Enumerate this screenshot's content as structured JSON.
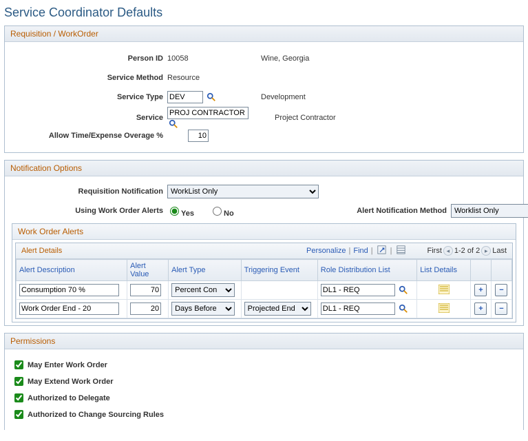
{
  "page_title": "Service Coordinator Defaults",
  "req": {
    "title": "Requisition / WorkOrder",
    "person_id_label": "Person ID",
    "person_id": "10058",
    "person_name": "Wine, Georgia",
    "service_method_label": "Service Method",
    "service_method": "Resource",
    "service_type_label": "Service Type",
    "service_type_value": "DEV",
    "service_type_desc": "Development",
    "service_label": "Service",
    "service_value": "PROJ CONTRACTOR",
    "service_desc": "Project Contractor",
    "overage_label": "Allow Time/Expense Overage %",
    "overage_value": "10"
  },
  "notif": {
    "title": "Notification Options",
    "req_notif_label": "Requisition Notification",
    "req_notif_value": "WorkList Only",
    "using_alerts_label": "Using Work Order Alerts",
    "yes_label": "Yes",
    "no_label": "No",
    "using_alerts": "Yes",
    "alert_method_label": "Alert Notification Method",
    "alert_method_value": "Worklist Only"
  },
  "alerts": {
    "grid_title": "Work Order Alerts",
    "sub_title": "Alert Details",
    "personalize": "Personalize",
    "find": "Find",
    "first": "First",
    "range": "1-2 of 2",
    "last": "Last",
    "cols": {
      "desc": "Alert Description",
      "value": "Alert Value",
      "type": "Alert Type",
      "trigger": "Triggering Event",
      "rdl": "Role Distribution List",
      "list": "List Details"
    },
    "rows": [
      {
        "desc": "Consumption 70 %",
        "value": "70",
        "type": "Percent Con",
        "trigger": "",
        "rdl": "DL1 - REQ"
      },
      {
        "desc": "Work Order End - 20",
        "value": "20",
        "type": "Days Before",
        "trigger": "Projected End",
        "rdl": "DL1 - REQ"
      }
    ]
  },
  "perm": {
    "title": "Permissions",
    "p1": "May Enter Work Order",
    "p2": "May Extend Work Order",
    "p3": "Authorized to Delegate",
    "p4": "Authorized to Change Sourcing Rules"
  }
}
